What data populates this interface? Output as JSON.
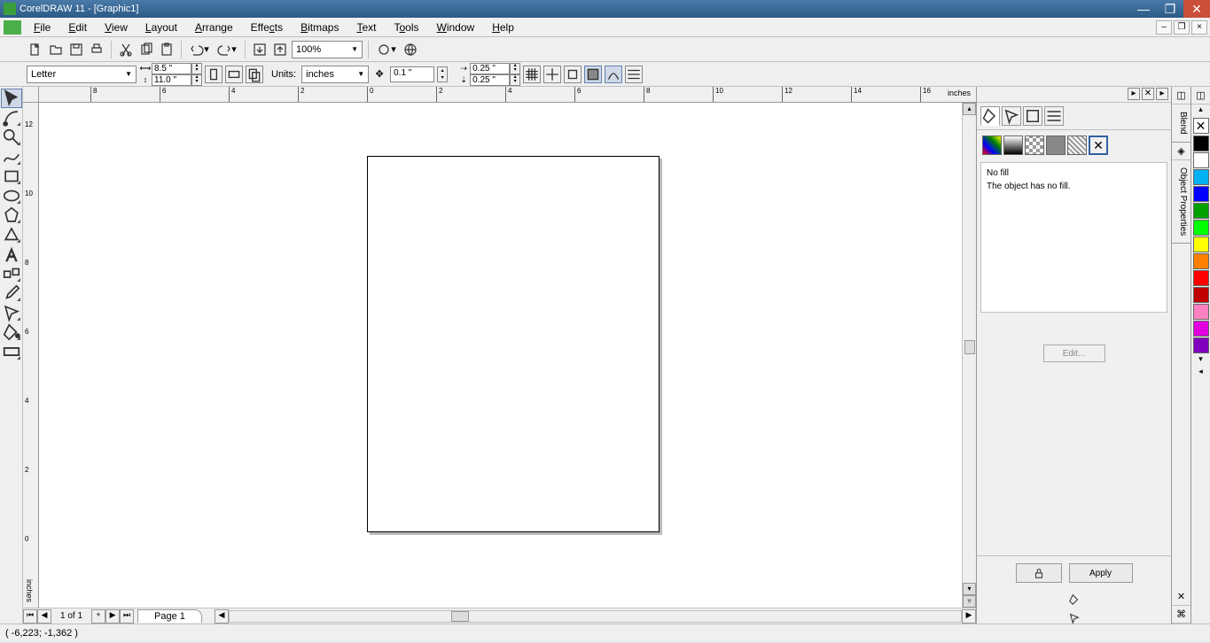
{
  "window": {
    "title": "CorelDRAW 11 - [Graphic1]"
  },
  "menu": {
    "file": "File",
    "edit": "Edit",
    "view": "View",
    "layout": "Layout",
    "arrange": "Arrange",
    "effects": "Effects",
    "bitmaps": "Bitmaps",
    "text": "Text",
    "tools": "Tools",
    "window": "Window",
    "help": "Help"
  },
  "toolbar": {
    "zoom": "100%"
  },
  "property": {
    "paper": "Letter",
    "width": "8.5 \"",
    "height": "11.0 \"",
    "units_label": "Units:",
    "units": "inches",
    "nudge": "0.1 \"",
    "dup_x": "0.25 \"",
    "dup_y": "0.25 \""
  },
  "ruler": {
    "unit": "inches",
    "h_ticks": [
      "0",
      "2",
      "4",
      "6",
      "8",
      "10",
      "12",
      "14",
      "16"
    ],
    "h_ticks_neg": [
      "-8",
      "-6",
      "-4",
      "-2"
    ],
    "v_ticks": [
      "12",
      "10",
      "8",
      "6",
      "4",
      "2",
      "0"
    ]
  },
  "pagenav": {
    "count": "1 of 1",
    "tab": "Page 1"
  },
  "docker": {
    "fill_title": "No fill",
    "fill_msg": "The object has no fill.",
    "edit": "Edit...",
    "apply": "Apply",
    "tab_blend": "Blend",
    "tab_props": "Object Properties"
  },
  "palette_colors": [
    "#000000",
    "#ffffff",
    "#00b0f0",
    "#0000ff",
    "#00a000",
    "#00ff00",
    "#ffff00",
    "#ff8000",
    "#ff0000",
    "#c00000",
    "#ff80c0",
    "#e000e0",
    "#8000c0"
  ],
  "status": {
    "coords": "( -6,223; -1,362 )"
  }
}
